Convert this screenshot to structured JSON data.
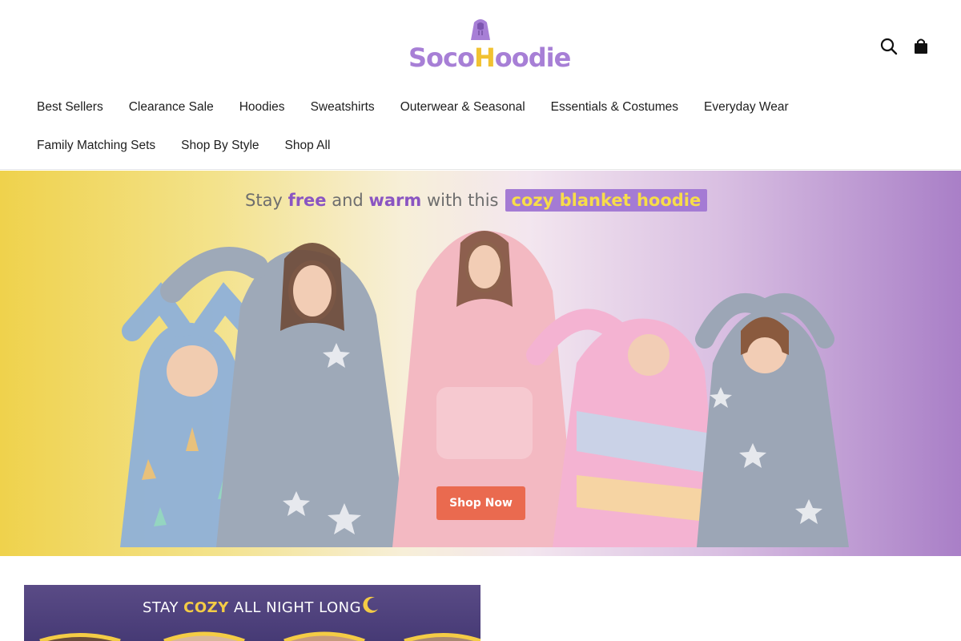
{
  "brand": {
    "logo_text": "Soco Hoodie",
    "colors": {
      "purple": "#a77fd6",
      "gold": "#f1c232"
    }
  },
  "header": {
    "search_icon": "search-icon",
    "cart_icon": "shopping-bag-icon"
  },
  "nav": {
    "rows": [
      [
        "Best Sellers",
        "Clearance Sale",
        "Hoodies",
        "Sweatshirts",
        "Outerwear & Seasonal",
        "Essentials & Costumes",
        "Everyday Wear"
      ],
      [
        "Family Matching Sets",
        "Shop By Style",
        "Shop All"
      ]
    ]
  },
  "hero": {
    "headline_prefix": "Stay",
    "headline_free": "free",
    "headline_mid": "and",
    "headline_warm": "warm",
    "headline_suffix": "with this",
    "headline_pill": "cozy blanket hoodie",
    "cta_label": "Shop Now",
    "cta_color": "#ea6a4f"
  },
  "promo": {
    "text_prefix": "STAY",
    "text_highlight": "COZY",
    "text_suffix": "ALL NIGHT LONG"
  }
}
